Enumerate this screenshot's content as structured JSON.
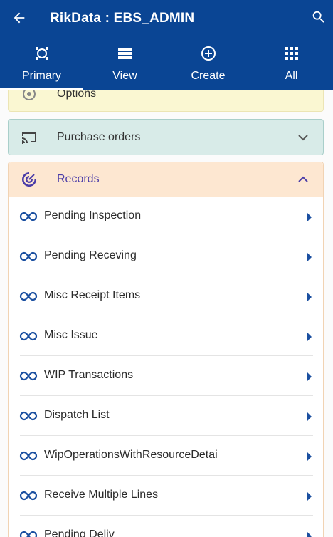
{
  "header": {
    "title": "RikData : EBS_ADMIN",
    "back_icon": "arrow-left-icon",
    "search_icon": "search-icon",
    "color": "#0a4594"
  },
  "tabs": [
    {
      "label": "Primary",
      "icon": "primary-icon",
      "active": true
    },
    {
      "label": "View",
      "icon": "list-view-icon",
      "active": false
    },
    {
      "label": "Create",
      "icon": "plus-circle-icon",
      "active": false
    },
    {
      "label": "All",
      "icon": "grid-icon",
      "active": false
    }
  ],
  "sections": {
    "options": {
      "label": "Options",
      "color": "#faf7d2"
    },
    "purchase_orders": {
      "label": "Purchase orders",
      "color": "#d8ebe8",
      "expanded": false
    },
    "records": {
      "label": "Records",
      "color": "#fde7d1",
      "expanded": true,
      "items": [
        {
          "label": "Pending Inspection"
        },
        {
          "label": "Pending Receving"
        },
        {
          "label": "Misc Receipt Items"
        },
        {
          "label": "Misc Issue"
        },
        {
          "label": "WIP Transactions"
        },
        {
          "label": "Dispatch List"
        },
        {
          "label": "WipOperationsWithResourceDetai"
        },
        {
          "label": "Receive Multiple Lines"
        },
        {
          "label": "Pending Deliv"
        }
      ]
    }
  }
}
